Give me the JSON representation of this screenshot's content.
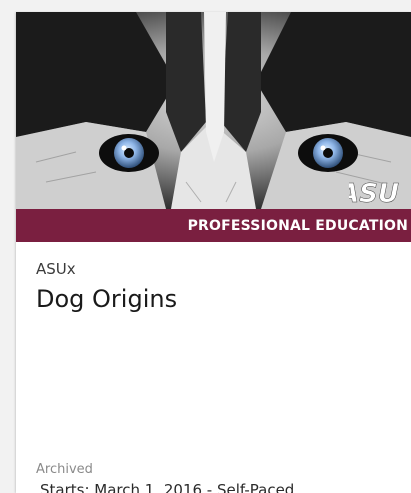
{
  "course_card": {
    "image_banner": "PROFESSIONAL EDUCATION",
    "logo_text": "ASU",
    "org": "ASUx",
    "title": "Dog Origins",
    "status": "Archived",
    "dates": "Starts: March 1, 2016 - Self-Paced"
  },
  "colors": {
    "banner": "#7a1f40",
    "eye_blue": "#8fb6e8"
  },
  "icons": {
    "hero": "husky-eyes-image",
    "logo": "asu-logo-icon"
  }
}
